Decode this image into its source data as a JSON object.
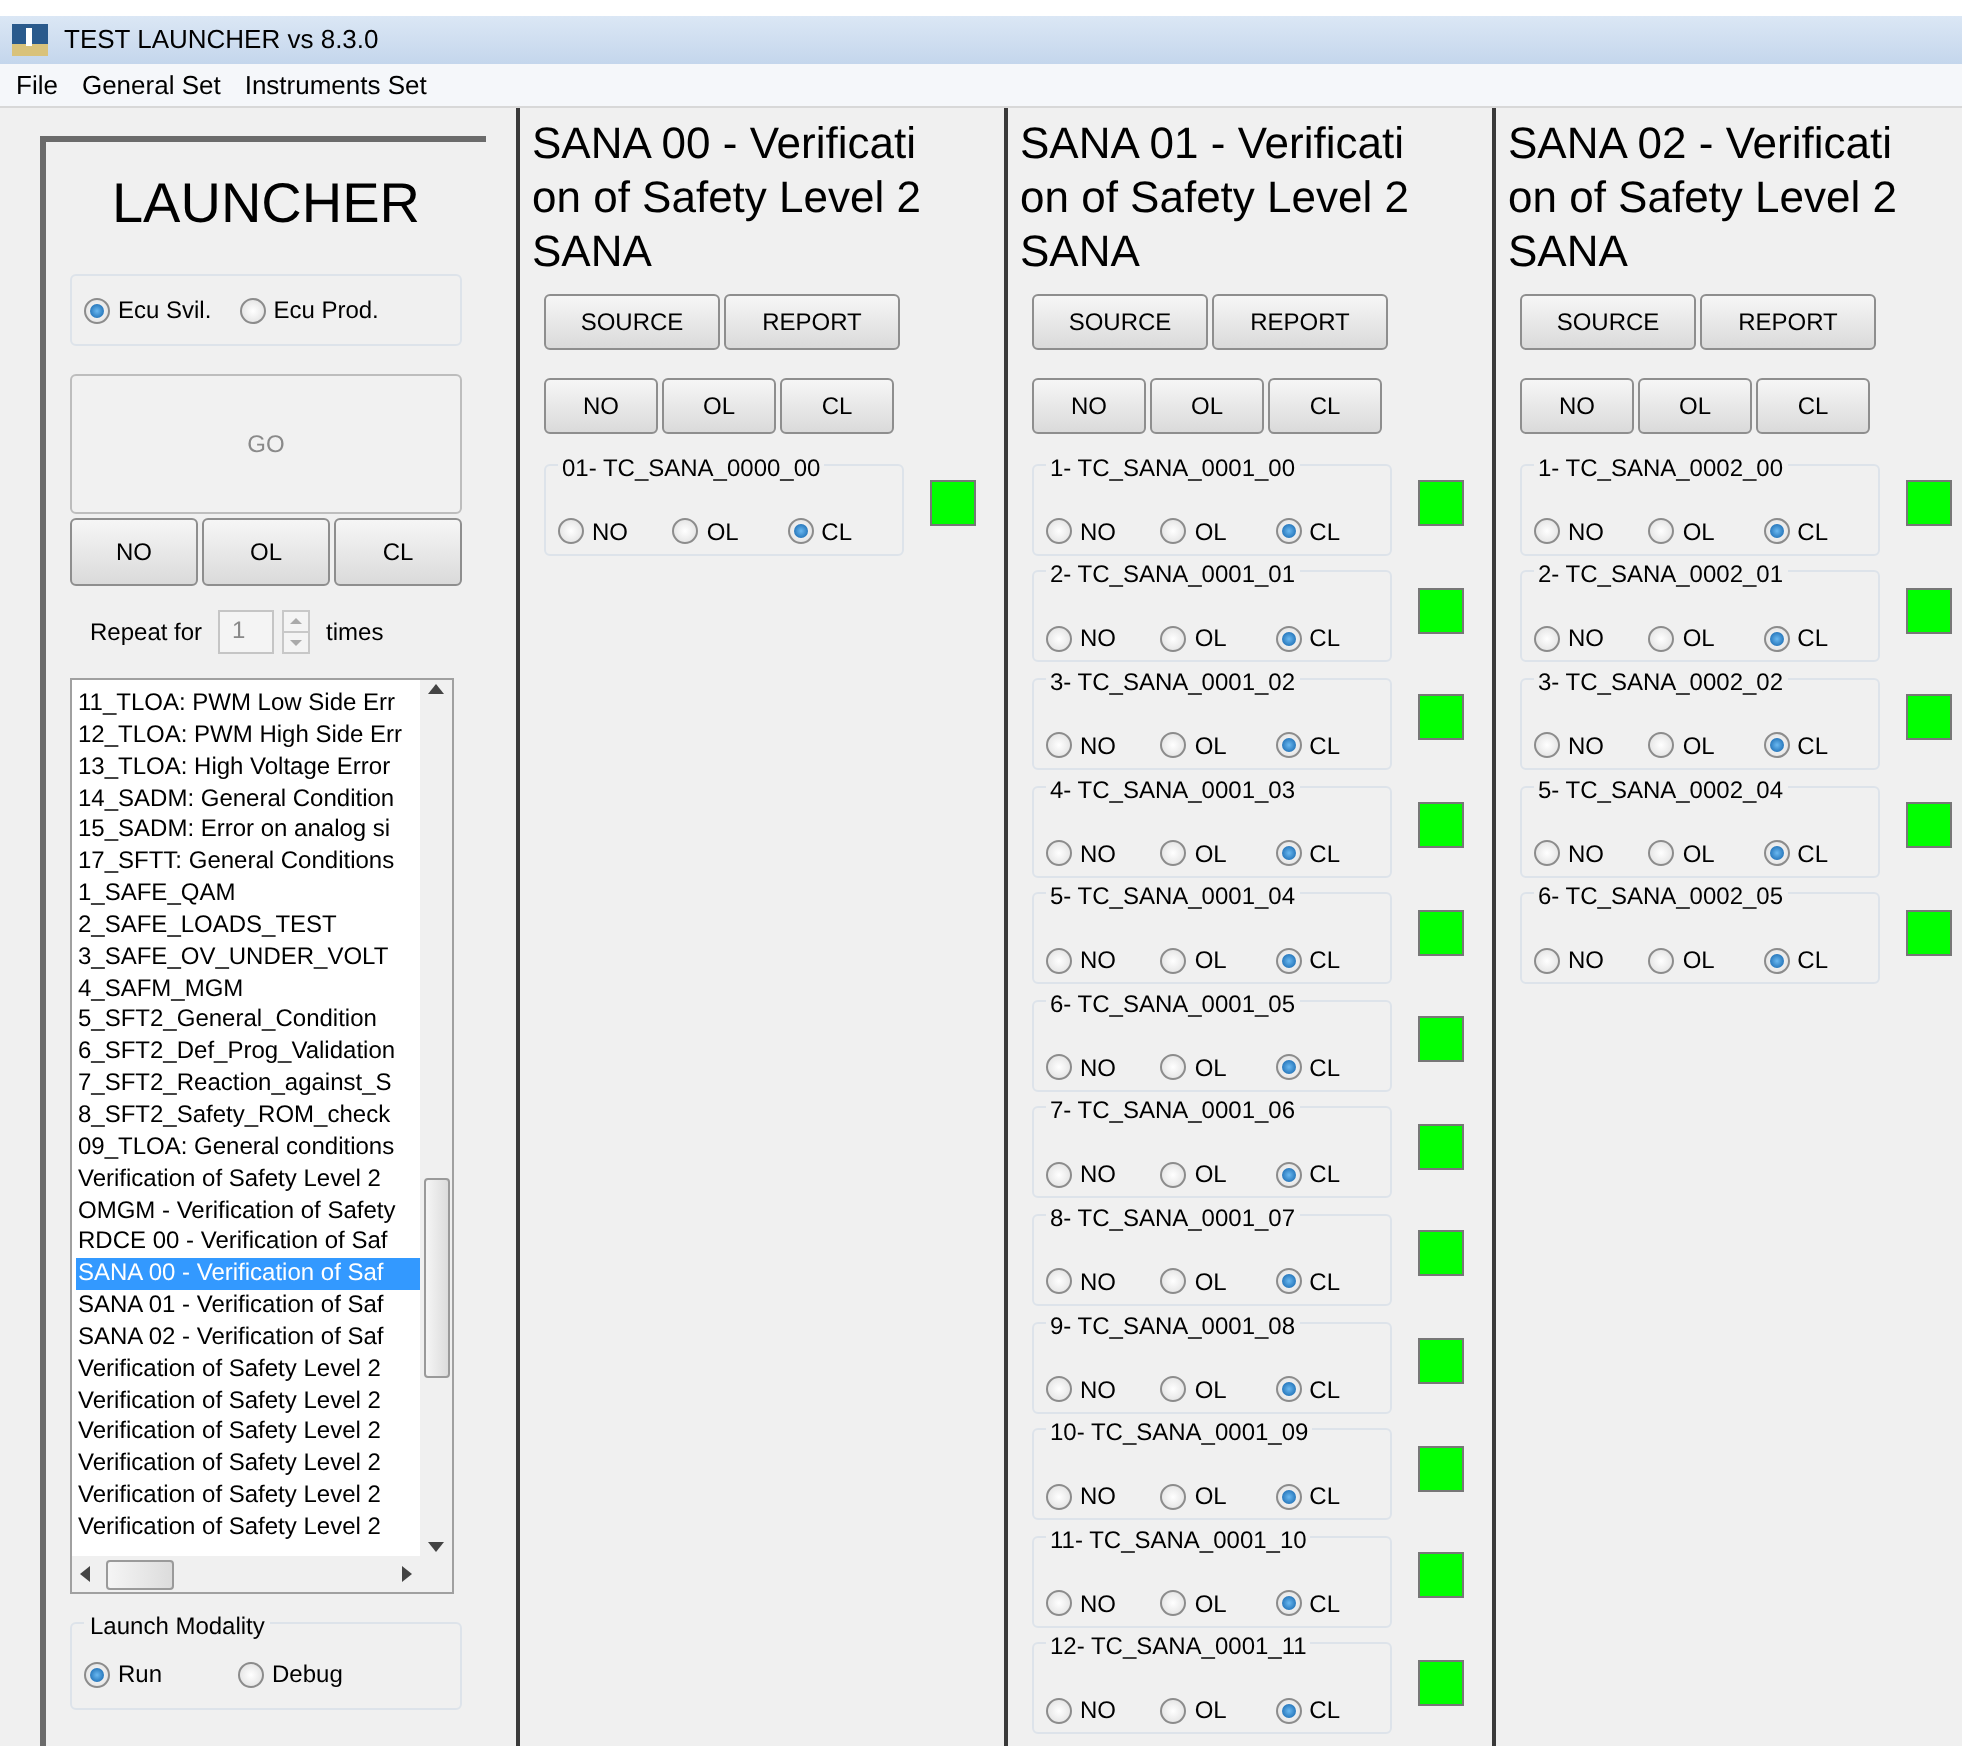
{
  "window": {
    "title": "TEST LAUNCHER vs 8.3.0"
  },
  "menu": [
    "File",
    "General Set",
    "Instruments Set"
  ],
  "launcher": {
    "title": "LAUNCHER",
    "ecu_options": [
      {
        "label": "Ecu Svil.",
        "selected": true
      },
      {
        "label": "Ecu Prod.",
        "selected": false
      }
    ],
    "go_button": {
      "label": "GO",
      "disabled": true
    },
    "buttons": [
      "NO",
      "OL",
      "CL"
    ],
    "repeat": {
      "label": "Repeat for",
      "value": "1",
      "suffix": "times",
      "disabled": true
    },
    "test_list": {
      "items": [
        {
          "label": "11_TLOA: PWM Low Side Err",
          "selected": false
        },
        {
          "label": "12_TLOA: PWM High Side Err",
          "selected": false
        },
        {
          "label": "13_TLOA: High Voltage Error",
          "selected": false
        },
        {
          "label": "14_SADM: General Condition",
          "selected": false
        },
        {
          "label": "15_SADM: Error on analog si",
          "selected": false
        },
        {
          "label": "17_SFTT: General Conditions",
          "selected": false
        },
        {
          "label": "1_SAFE_QAM",
          "selected": false
        },
        {
          "label": "2_SAFE_LOADS_TEST",
          "selected": false
        },
        {
          "label": "3_SAFE_OV_UNDER_VOLT",
          "selected": false
        },
        {
          "label": "4_SAFM_MGM",
          "selected": false
        },
        {
          "label": "5_SFT2_General_Condition",
          "selected": false
        },
        {
          "label": "6_SFT2_Def_Prog_Validation",
          "selected": false
        },
        {
          "label": "7_SFT2_Reaction_against_S",
          "selected": false
        },
        {
          "label": "8_SFT2_Safety_ROM_check",
          "selected": false
        },
        {
          "label": "09_TLOA: General conditions",
          "selected": false
        },
        {
          "label": "Verification of Safety Level 2",
          "selected": false
        },
        {
          "label": "OMGM - Verification of Safety",
          "selected": false
        },
        {
          "label": "RDCE 00 - Verification of Saf",
          "selected": false
        },
        {
          "label": "SANA 00 - Verification of Saf",
          "selected": true
        },
        {
          "label": "SANA 01 - Verification of Saf",
          "selected": false
        },
        {
          "label": "SANA 02 - Verification of Saf",
          "selected": false
        },
        {
          "label": "Verification of Safety Level 2",
          "selected": false
        },
        {
          "label": "Verification of Safety Level 2",
          "selected": false
        },
        {
          "label": "Verification of Safety Level 2",
          "selected": false
        },
        {
          "label": "Verification of Safety Level 2",
          "selected": false
        },
        {
          "label": "Verification of Safety Level 2",
          "selected": false
        },
        {
          "label": "Verification of Safety Level 2",
          "selected": false
        }
      ]
    },
    "launch_modality": {
      "title": "Launch Modality",
      "options": [
        {
          "label": "Run",
          "selected": true
        },
        {
          "label": "Debug",
          "selected": false
        }
      ]
    }
  },
  "sections": [
    {
      "title": "SANA 00 - Verification of Safety Level 2 SANA",
      "buttons": [
        "SOURCE",
        "REPORT"
      ],
      "mode_buttons": [
        "NO",
        "OL",
        "CL"
      ],
      "test_cases": [
        {
          "label": "01- TC_SANA_0000_00",
          "color": "#00ff00",
          "options": [
            {
              "label": "NO",
              "selected": false
            },
            {
              "label": "OL",
              "selected": false
            },
            {
              "label": "CL",
              "selected": true
            }
          ]
        }
      ]
    },
    {
      "title": "SANA 01 - Verification of Safety Level 2 SANA",
      "buttons": [
        "SOURCE",
        "REPORT"
      ],
      "mode_buttons": [
        "NO",
        "OL",
        "CL"
      ],
      "test_cases": [
        {
          "label": "1- TC_SANA_0001_00",
          "color": "#00ff00",
          "options": [
            {
              "label": "NO",
              "selected": false
            },
            {
              "label": "OL",
              "selected": false
            },
            {
              "label": "CL",
              "selected": true
            }
          ]
        },
        {
          "label": "2- TC_SANA_0001_01",
          "color": "#00ff00",
          "options": [
            {
              "label": "NO",
              "selected": false
            },
            {
              "label": "OL",
              "selected": false
            },
            {
              "label": "CL",
              "selected": true
            }
          ]
        },
        {
          "label": "3- TC_SANA_0001_02",
          "color": "#00ff00",
          "options": [
            {
              "label": "NO",
              "selected": false
            },
            {
              "label": "OL",
              "selected": false
            },
            {
              "label": "CL",
              "selected": true
            }
          ]
        },
        {
          "label": "4- TC_SANA_0001_03",
          "color": "#00ff00",
          "options": [
            {
              "label": "NO",
              "selected": false
            },
            {
              "label": "OL",
              "selected": false
            },
            {
              "label": "CL",
              "selected": true
            }
          ]
        },
        {
          "label": "5- TC_SANA_0001_04",
          "color": "#00ff00",
          "options": [
            {
              "label": "NO",
              "selected": false
            },
            {
              "label": "OL",
              "selected": false
            },
            {
              "label": "CL",
              "selected": true
            }
          ]
        },
        {
          "label": "6- TC_SANA_0001_05",
          "color": "#00ff00",
          "options": [
            {
              "label": "NO",
              "selected": false
            },
            {
              "label": "OL",
              "selected": false
            },
            {
              "label": "CL",
              "selected": true
            }
          ]
        },
        {
          "label": "7- TC_SANA_0001_06",
          "color": "#00ff00",
          "options": [
            {
              "label": "NO",
              "selected": false
            },
            {
              "label": "OL",
              "selected": false
            },
            {
              "label": "CL",
              "selected": true
            }
          ]
        },
        {
          "label": "8- TC_SANA_0001_07",
          "color": "#00ff00",
          "options": [
            {
              "label": "NO",
              "selected": false
            },
            {
              "label": "OL",
              "selected": false
            },
            {
              "label": "CL",
              "selected": true
            }
          ]
        },
        {
          "label": "9- TC_SANA_0001_08",
          "color": "#00ff00",
          "options": [
            {
              "label": "NO",
              "selected": false
            },
            {
              "label": "OL",
              "selected": false
            },
            {
              "label": "CL",
              "selected": true
            }
          ]
        },
        {
          "label": "10- TC_SANA_0001_09",
          "color": "#00ff00",
          "options": [
            {
              "label": "NO",
              "selected": false
            },
            {
              "label": "OL",
              "selected": false
            },
            {
              "label": "CL",
              "selected": true
            }
          ]
        },
        {
          "label": "11- TC_SANA_0001_10",
          "color": "#00ff00",
          "options": [
            {
              "label": "NO",
              "selected": false
            },
            {
              "label": "OL",
              "selected": false
            },
            {
              "label": "CL",
              "selected": true
            }
          ]
        },
        {
          "label": "12- TC_SANA_0001_11",
          "color": "#00ff00",
          "options": [
            {
              "label": "NO",
              "selected": false
            },
            {
              "label": "OL",
              "selected": false
            },
            {
              "label": "CL",
              "selected": true
            }
          ]
        }
      ]
    },
    {
      "title": "SANA 02 - Verification of Safety Level 2 SANA",
      "buttons": [
        "SOURCE",
        "REPORT"
      ],
      "mode_buttons": [
        "NO",
        "OL",
        "CL"
      ],
      "test_cases": [
        {
          "label": "1- TC_SANA_0002_00",
          "color": "#00ff00",
          "options": [
            {
              "label": "NO",
              "selected": false
            },
            {
              "label": "OL",
              "selected": false
            },
            {
              "label": "CL",
              "selected": true
            }
          ]
        },
        {
          "label": "2- TC_SANA_0002_01",
          "color": "#00ff00",
          "options": [
            {
              "label": "NO",
              "selected": false
            },
            {
              "label": "OL",
              "selected": false
            },
            {
              "label": "CL",
              "selected": true
            }
          ]
        },
        {
          "label": "3- TC_SANA_0002_02",
          "color": "#00ff00",
          "options": [
            {
              "label": "NO",
              "selected": false
            },
            {
              "label": "OL",
              "selected": false
            },
            {
              "label": "CL",
              "selected": true
            }
          ]
        },
        {
          "label": "5- TC_SANA_0002_04",
          "color": "#00ff00",
          "options": [
            {
              "label": "NO",
              "selected": false
            },
            {
              "label": "OL",
              "selected": false
            },
            {
              "label": "CL",
              "selected": true
            }
          ]
        },
        {
          "label": "6- TC_SANA_0002_05",
          "color": "#00ff00",
          "options": [
            {
              "label": "NO",
              "selected": false
            },
            {
              "label": "OL",
              "selected": false
            },
            {
              "label": "CL",
              "selected": true
            }
          ]
        }
      ]
    }
  ]
}
